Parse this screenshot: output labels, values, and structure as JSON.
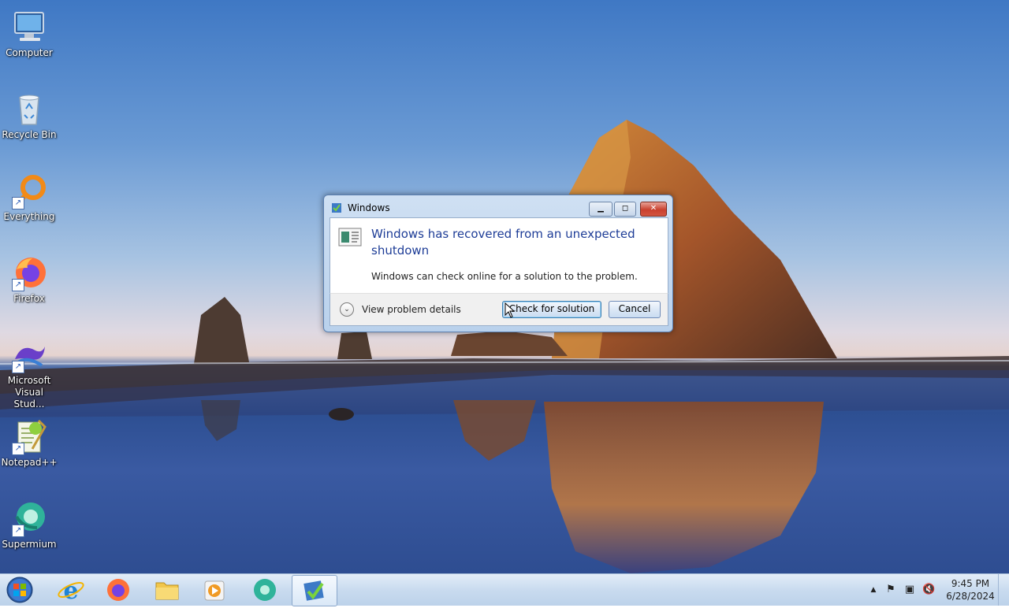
{
  "desktop": {
    "icons": [
      {
        "label": "Computer",
        "icon": "computer-icon"
      },
      {
        "label": "Recycle Bin",
        "icon": "recycle-bin-icon"
      },
      {
        "label": "Everything",
        "icon": "everything-search-icon"
      },
      {
        "label": "Firefox",
        "icon": "firefox-icon"
      },
      {
        "label": "Microsoft Visual Stud...",
        "icon": "visual-studio-icon"
      },
      {
        "label": "Notepad++",
        "icon": "notepad-plus-plus-icon"
      },
      {
        "label": "Supermium",
        "icon": "supermium-icon"
      }
    ]
  },
  "dialog": {
    "title": "Windows",
    "headline": "Windows has recovered from an unexpected shutdown",
    "subtext": "Windows can check online for a solution to the problem.",
    "details_label": "View problem details",
    "check_button": "Check for solution",
    "cancel_button": "Cancel",
    "minimize_glyph": "▁",
    "maximize_glyph": "◻",
    "close_glyph": "✕"
  },
  "taskbar": {
    "items": [
      {
        "icon": "internet-explorer-icon"
      },
      {
        "icon": "firefox-icon"
      },
      {
        "icon": "file-explorer-icon"
      },
      {
        "icon": "media-player-icon"
      },
      {
        "icon": "supermium-icon"
      },
      {
        "icon": "problem-reporting-icon",
        "active": true
      }
    ],
    "tray": {
      "chevron": "▲",
      "flag": "⚑",
      "network": "▣",
      "volume": "🔇"
    },
    "clock": {
      "time": "9:45 PM",
      "date": "6/28/2024"
    }
  },
  "colors": {
    "headline": "#1e3d97",
    "close_button": "#c9412f",
    "taskbar": "#c9dbef"
  }
}
